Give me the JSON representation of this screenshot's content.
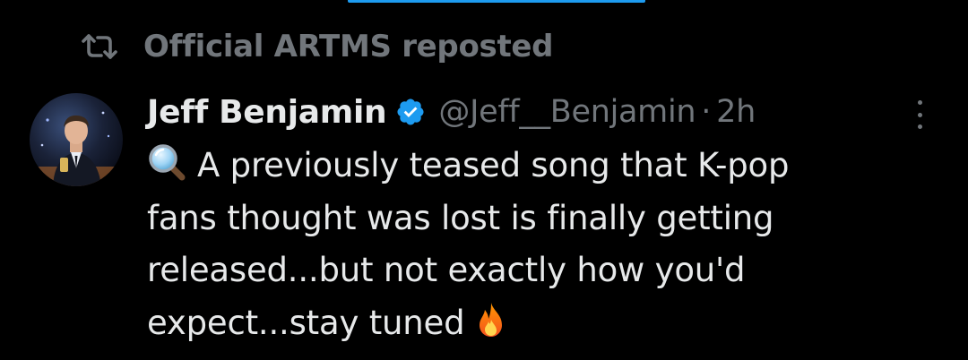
{
  "repost": {
    "icon": "repost-icon",
    "text": "Official ARTMS reposted"
  },
  "tweet": {
    "author": {
      "display_name": "Jeff Benjamin",
      "verified": true,
      "handle": "@Jeff__Benjamin",
      "avatar_icon": "avatar"
    },
    "separator": "·",
    "timestamp": "2h",
    "menu_icon": "more-icon",
    "text_lines": [
      "A previously teased song that K-pop",
      "fans thought was lost is finally getting",
      "released...but not exactly how you'd",
      "expect...stay tuned"
    ],
    "leading_emoji": "magnifying-glass-emoji",
    "trailing_emoji": "fire-emoji"
  },
  "colors": {
    "background": "#000000",
    "primary_text": "#e7e9ea",
    "secondary_text": "#71767b",
    "verified_blue": "#1d9bf0"
  }
}
